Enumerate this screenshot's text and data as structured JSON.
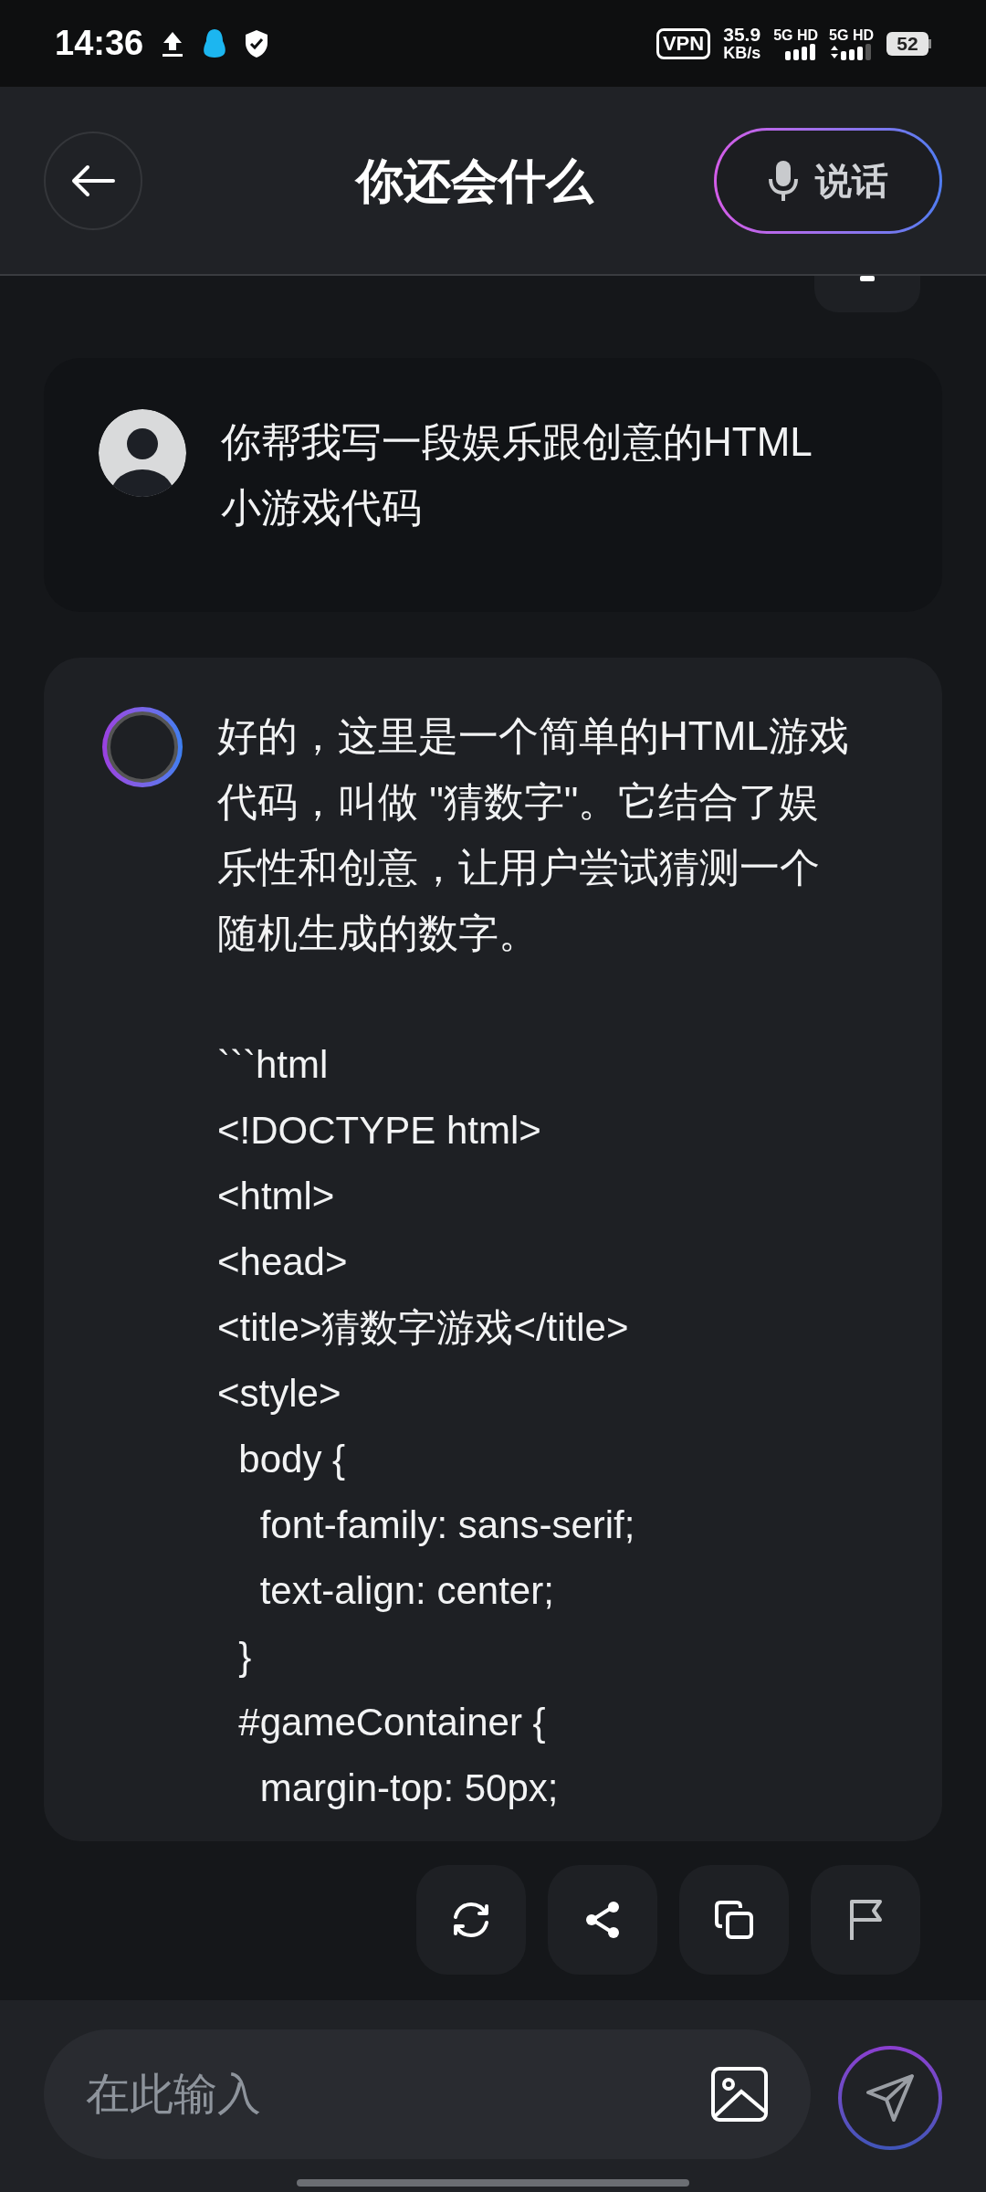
{
  "status_bar": {
    "time": "14:36",
    "vpn": "VPN",
    "speed_value": "35.9",
    "speed_unit": "KB/s",
    "sim_labels": [
      "5G HD",
      "5G HD"
    ],
    "battery": "52"
  },
  "header": {
    "title": "你还会什么",
    "voice_button": "说话"
  },
  "messages": [
    {
      "kind": "user",
      "text": "你帮我写一段娱乐跟创意的HTML小游戏代码"
    },
    {
      "kind": "assistant",
      "text": "好的，这里是一个简单的HTML游戏代码，叫做 \"猜数字\"。它结合了娱乐性和创意，让用户尝试猜测一个随机生成的数字。",
      "code_lines": [
        "```html",
        "<!DOCTYPE html>",
        "<html>",
        "<head>",
        "<title>猜数字游戏</title>",
        "<style>",
        "  body {",
        "    font-family: sans-serif;",
        "    text-align: center;",
        "  }",
        "  #gameContainer {",
        "    margin-top: 50px;"
      ]
    }
  ],
  "input": {
    "placeholder": "在此输入"
  }
}
